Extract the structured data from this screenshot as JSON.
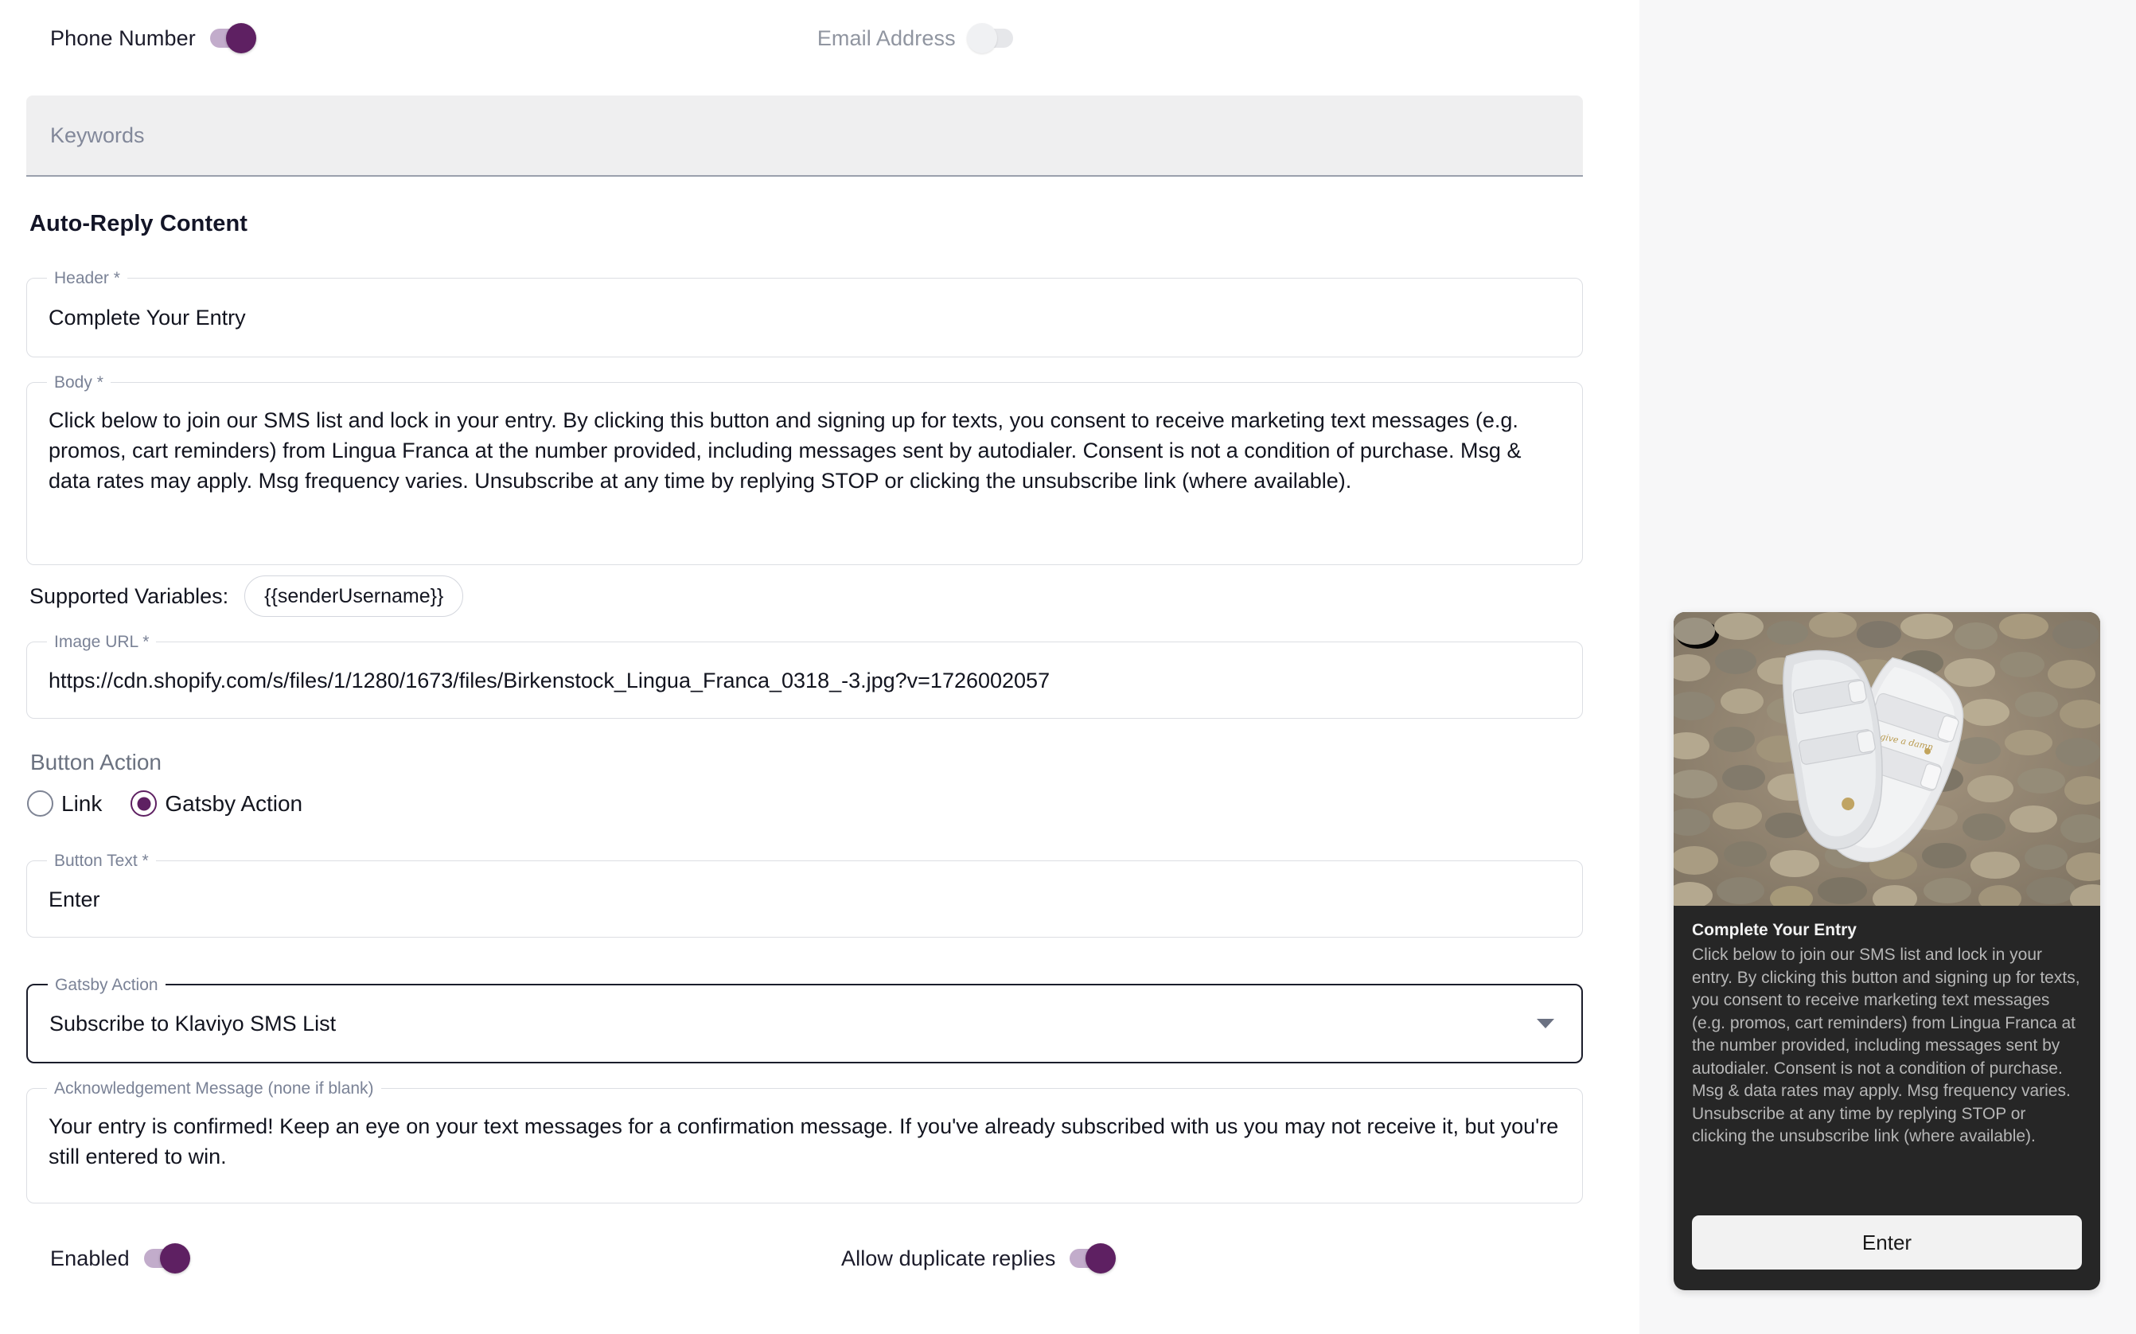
{
  "channel_toggles": {
    "phone": {
      "label": "Phone Number",
      "state": "on"
    },
    "email": {
      "label": "Email Address",
      "state": "off"
    }
  },
  "keywords": {
    "placeholder": "Keywords",
    "value": ""
  },
  "section": {
    "title": "Auto-Reply Content"
  },
  "fields": {
    "header": {
      "label": "Header",
      "required_mark": " *",
      "value": "Complete Your Entry"
    },
    "body": {
      "label": "Body",
      "required_mark": " *",
      "value": "Click below to join our SMS list and lock in your entry. By clicking this button and signing up for texts, you consent to receive marketing text messages (e.g. promos, cart reminders) from Lingua Franca at the number provided, including messages sent by autodialer. Consent is not a condition of purchase. Msg & data rates may apply. Msg frequency varies. Unsubscribe at any time by replying STOP or clicking the unsubscribe link (where available)."
    },
    "image_url": {
      "label": "Image URL",
      "required_mark": " *",
      "value": "https://cdn.shopify.com/s/files/1/1280/1673/files/Birkenstock_Lingua_Franca_0318_-3.jpg?v=1726002057"
    },
    "button_text": {
      "label": "Button Text",
      "required_mark": " *",
      "value": "Enter"
    },
    "gatsby_action": {
      "label": "Gatsby Action",
      "required_mark": "",
      "value": "Subscribe to Klaviyo SMS List"
    },
    "acknowledgement": {
      "label": "Acknowledgement Message (none if blank)",
      "required_mark": "",
      "value": "Your entry is confirmed! Keep an eye on your text messages for a confirmation message. If you've already subscribed with us you may not receive it, but you're still entered to win."
    }
  },
  "supported_variables": {
    "label": "Supported Variables:",
    "chips": [
      "{{senderUsername}}"
    ]
  },
  "button_action": {
    "title": "Button Action",
    "options": [
      {
        "label": "Link",
        "selected": false
      },
      {
        "label": "Gatsby Action",
        "selected": true
      }
    ]
  },
  "bottom_toggles": {
    "enabled": {
      "label": "Enabled",
      "state": "on"
    },
    "allow_duplicates": {
      "label": "Allow duplicate replies",
      "state": "on"
    }
  },
  "preview": {
    "image_alt": "white-birkenstock-sandals-on-pebbles",
    "header": "Complete Your Entry",
    "body": "Click below to join our SMS list and lock in your entry. By clicking this button and signing up for texts, you consent to receive marketing text messages (e.g. promos, cart reminders) from Lingua Franca at the number provided, including messages sent by autodialer. Consent is not a condition of purchase. Msg & data rates may apply. Msg frequency varies. Unsubscribe at any time by replying STOP or clicking the unsubscribe link (where available).",
    "button_label": "Enter"
  },
  "colors": {
    "accent_purple": "#5e2062",
    "track_purple": "#b79dc2",
    "field_border": "#dcdee3",
    "field_border_strong": "#1b1d2b",
    "label_grey": "#7a8296",
    "preview_bg": "#262626",
    "preview_panel": "#f7f7f8"
  }
}
